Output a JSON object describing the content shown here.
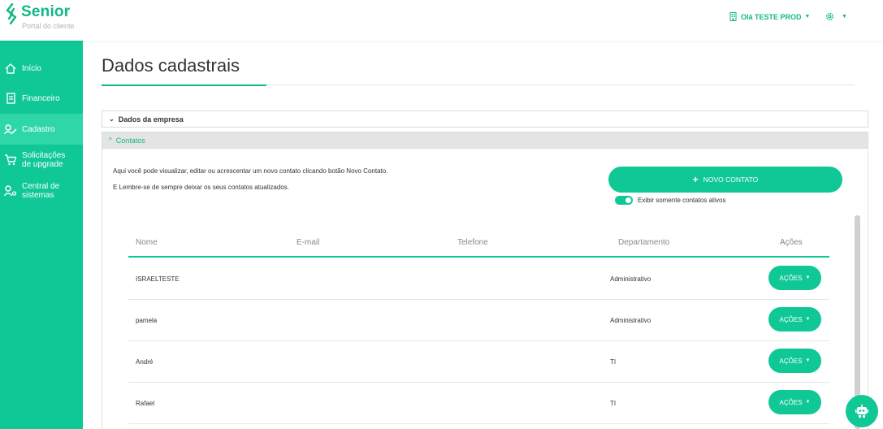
{
  "brand": {
    "name": "Senior",
    "subtitle": "Portal do cliente"
  },
  "header": {
    "user_greeting": "Olá TESTE PROD"
  },
  "sidebar": {
    "items": [
      {
        "label_line1": "Início",
        "label_line2": "",
        "icon": "home-icon"
      },
      {
        "label_line1": "Financeiro",
        "label_line2": "",
        "icon": "invoice-icon"
      },
      {
        "label_line1": "Cadastro",
        "label_line2": "",
        "icon": "user-edit-icon"
      },
      {
        "label_line1": "Solicitações",
        "label_line2": "de upgrade",
        "icon": "cart-icon"
      },
      {
        "label_line1": "Central de",
        "label_line2": "sistemas",
        "icon": "user-settings-icon"
      }
    ]
  },
  "page": {
    "title": "Dados cadastrais"
  },
  "accordions": {
    "empresa": "Dados da empresa",
    "contatos": "Contatos"
  },
  "contacts": {
    "info_line1": "Aqui você pode visualizar, editar ou acrescentar um novo contato clicando botão Novo Contato.",
    "info_line2": "E Lembre-se de sempre deixar os seus contatos atualizados.",
    "new_button": "NOVO CONTATO",
    "toggle_label": "Exibir somente contatos ativos",
    "toggle_on": true,
    "columns": [
      "Nome",
      "E-mail",
      "Telefone",
      "Departamento",
      "Ações"
    ],
    "rows": [
      {
        "name": "ISRAELTESTE",
        "department": "Administrativo",
        "action": "AÇÕES"
      },
      {
        "name": "pamela",
        "department": "Administrativo",
        "action": "AÇÕES"
      },
      {
        "name": "André",
        "department": "TI",
        "action": "AÇÕES"
      },
      {
        "name": "Rafael",
        "department": "TI",
        "action": "AÇÕES"
      }
    ]
  },
  "colors": {
    "accent": "#10c896",
    "accent_text": "#10b887",
    "sidebar_active": "#2fd6a8"
  }
}
